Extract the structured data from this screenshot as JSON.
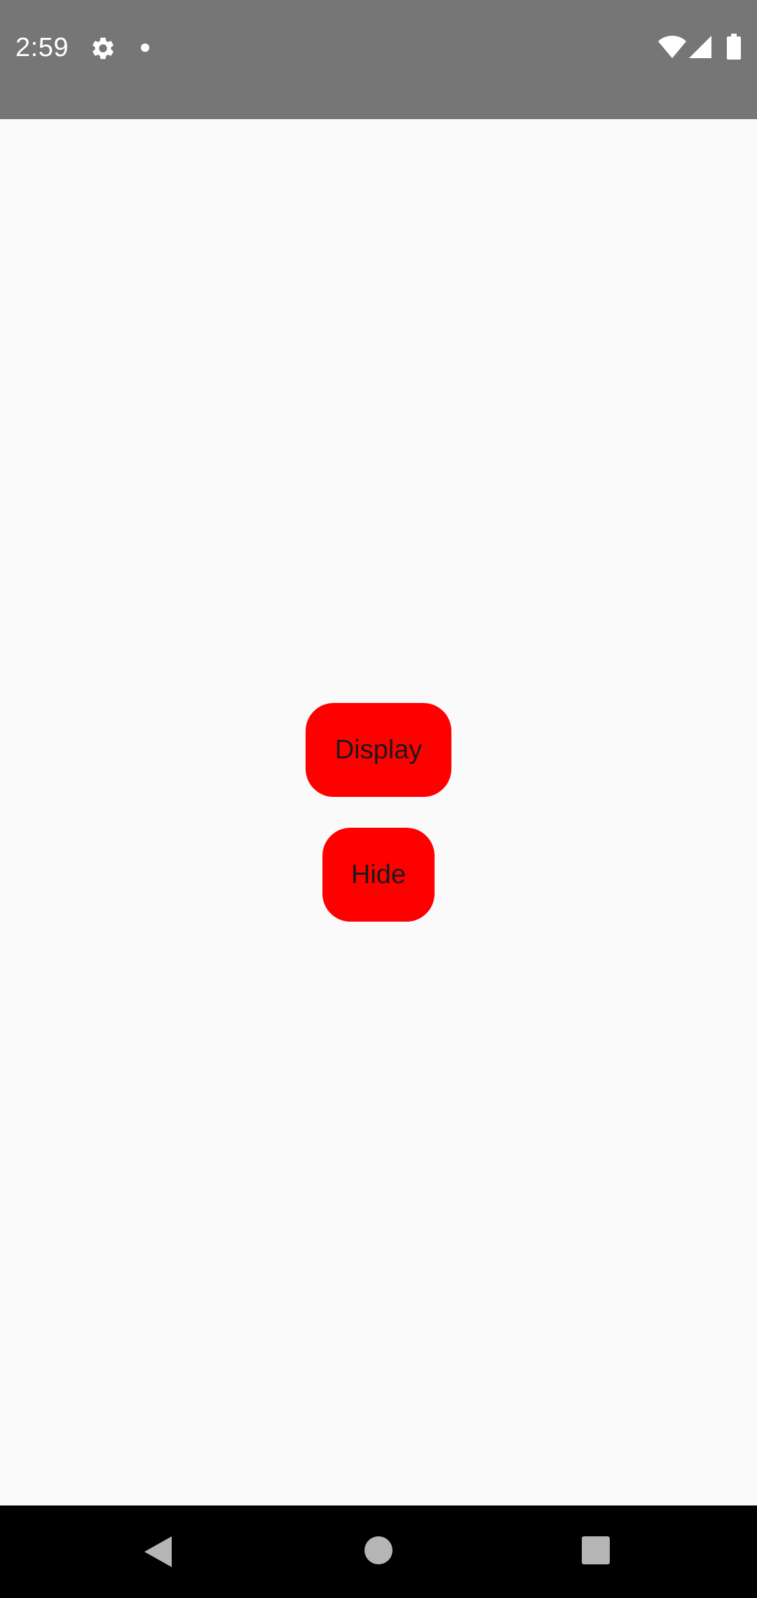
{
  "status_bar": {
    "time": "2:59",
    "background_color": "#767676",
    "icons": [
      "gear-icon",
      "notification-dot-icon",
      "wifi-icon",
      "cell-signal-icon",
      "battery-icon"
    ]
  },
  "main": {
    "background_color": "#fafafa",
    "buttons": {
      "display_label": "Display",
      "hide_label": "Hide",
      "color": "#ff0000"
    }
  },
  "nav_bar": {
    "background_color": "#000000",
    "icons": [
      "back-icon",
      "home-icon",
      "recents-icon"
    ]
  }
}
